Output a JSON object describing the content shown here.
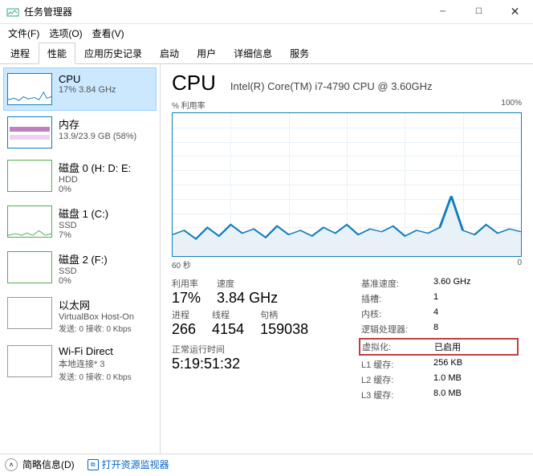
{
  "window": {
    "title": "任务管理器"
  },
  "menus": {
    "file": "文件(F)",
    "options": "选项(O)",
    "view": "查看(V)"
  },
  "tabs": [
    "进程",
    "性能",
    "应用历史记录",
    "启动",
    "用户",
    "详细信息",
    "服务"
  ],
  "active_tab": 1,
  "sidebar": {
    "items": [
      {
        "name": "CPU",
        "sub": "17%  3.84 GHz"
      },
      {
        "name": "内存",
        "sub": "13.9/23.9 GB (58%)"
      },
      {
        "name": "磁盘 0 (H: D: E:",
        "sub": "HDD",
        "val": "0%"
      },
      {
        "name": "磁盘 1 (C:)",
        "sub": "SSD",
        "val": "7%"
      },
      {
        "name": "磁盘 2 (F:)",
        "sub": "SSD",
        "val": "0%"
      },
      {
        "name": "以太网",
        "sub": "VirtualBox Host-On",
        "val": "发送: 0  接收: 0 Kbps"
      },
      {
        "name": "Wi-Fi Direct",
        "sub": "本地连接* 3",
        "val": "发送: 0  接收: 0 Kbps"
      }
    ]
  },
  "main": {
    "title": "CPU",
    "model": "Intel(R) Core(TM) i7-4790 CPU @ 3.60GHz",
    "chart_top_left": "% 利用率",
    "chart_top_right": "100%",
    "chart_bottom_left": "60 秒",
    "chart_bottom_right": "0",
    "left": {
      "row1": [
        {
          "lbl": "利用率",
          "val": "17%"
        },
        {
          "lbl": "速度",
          "val": "3.84 GHz"
        }
      ],
      "row2": [
        {
          "lbl": "进程",
          "val": "266"
        },
        {
          "lbl": "线程",
          "val": "4154"
        },
        {
          "lbl": "句柄",
          "val": "159038"
        }
      ],
      "uptime_lbl": "正常运行时间",
      "uptime_val": "5:19:51:32"
    },
    "right": [
      {
        "lbl": "基准速度:",
        "val": "3.60 GHz"
      },
      {
        "lbl": "插槽:",
        "val": "1"
      },
      {
        "lbl": "内核:",
        "val": "4"
      },
      {
        "lbl": "逻辑处理器:",
        "val": "8"
      },
      {
        "lbl": "虚拟化:",
        "val": "已启用",
        "boxed": true
      },
      {
        "lbl": "L1 缓存:",
        "val": "256 KB"
      },
      {
        "lbl": "L2 缓存:",
        "val": "1.0 MB"
      },
      {
        "lbl": "L3 缓存:",
        "val": "8.0 MB"
      }
    ]
  },
  "footer": {
    "less": "简略信息(D)",
    "monitor": "打开资源监视器"
  },
  "chart_data": {
    "type": "line",
    "title": "% 利用率",
    "xlabel": "60 秒 → 0",
    "ylabel": "利用率 %",
    "ylim": [
      0,
      100
    ],
    "x_seconds_ago": [
      60,
      58,
      56,
      54,
      52,
      50,
      48,
      46,
      44,
      42,
      40,
      38,
      36,
      34,
      32,
      30,
      28,
      26,
      24,
      22,
      20,
      18,
      16,
      14,
      12,
      10,
      8,
      6,
      4,
      2,
      0
    ],
    "values": [
      15,
      18,
      12,
      20,
      14,
      22,
      16,
      19,
      13,
      21,
      15,
      18,
      14,
      20,
      16,
      22,
      15,
      19,
      17,
      21,
      14,
      18,
      16,
      20,
      42,
      18,
      15,
      22,
      16,
      19,
      17
    ]
  }
}
